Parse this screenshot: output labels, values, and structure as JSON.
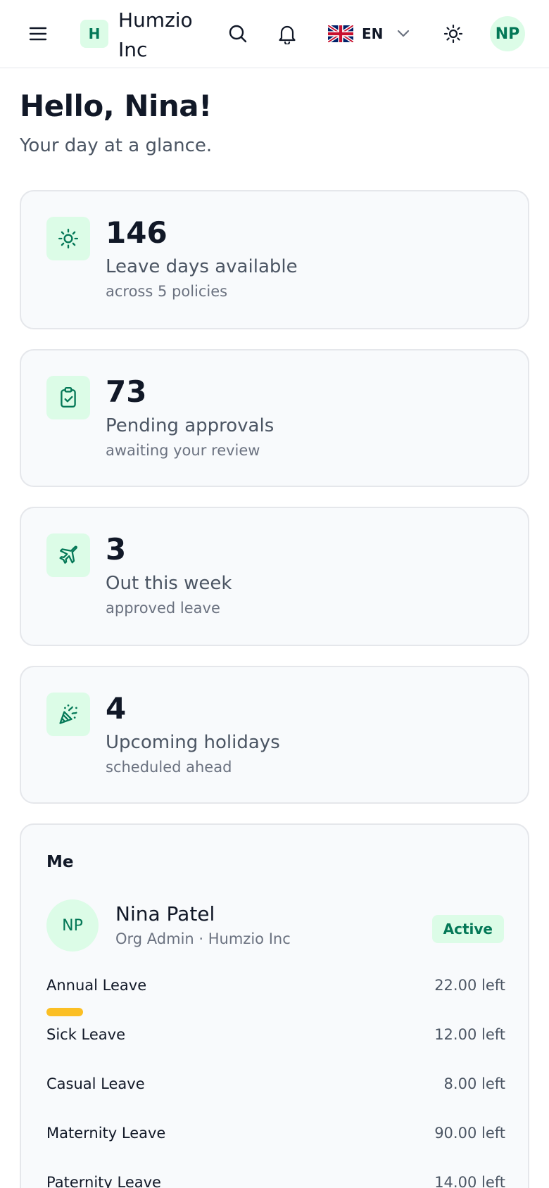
{
  "header": {
    "brand_initial": "H",
    "brand_name": "Humzio Inc",
    "language_code": "EN",
    "avatar_initials": "NP",
    "icons": [
      "menu-icon",
      "search-icon",
      "bell-icon",
      "uk-flag-icon",
      "chevron-down-icon",
      "sun-icon"
    ]
  },
  "greeting": {
    "title": "Hello, Nina!",
    "subtitle": "Your day at a glance."
  },
  "stats": [
    {
      "icon": "sun-icon",
      "value": "146",
      "label": "Leave days available",
      "sub": "across 5 policies"
    },
    {
      "icon": "clipboard-check-icon",
      "value": "73",
      "label": "Pending approvals",
      "sub": "awaiting your review"
    },
    {
      "icon": "plane-icon",
      "value": "3",
      "label": "Out this week",
      "sub": "approved leave"
    },
    {
      "icon": "party-popper-icon",
      "value": "4",
      "label": "Upcoming holidays",
      "sub": "scheduled ahead"
    }
  ],
  "me": {
    "title": "Me",
    "avatar_initials": "NP",
    "name": "Nina Patel",
    "role": "Org Admin · Humzio Inc",
    "status": "Active",
    "leaves": [
      {
        "name": "Annual Leave",
        "left": "22.00 left",
        "usage_fraction": 0.08
      },
      {
        "name": "Sick Leave",
        "left": "12.00 left",
        "usage_fraction": 0
      },
      {
        "name": "Casual Leave",
        "left": "8.00 left",
        "usage_fraction": 0
      },
      {
        "name": "Maternity Leave",
        "left": "90.00 left",
        "usage_fraction": 0
      },
      {
        "name": "Paternity Leave",
        "left": "14.00 left",
        "usage_fraction": 0
      }
    ]
  },
  "colors": {
    "accent": "#047857",
    "accent_soft": "#dcfce7",
    "usage_bar": "#fbbf24"
  }
}
